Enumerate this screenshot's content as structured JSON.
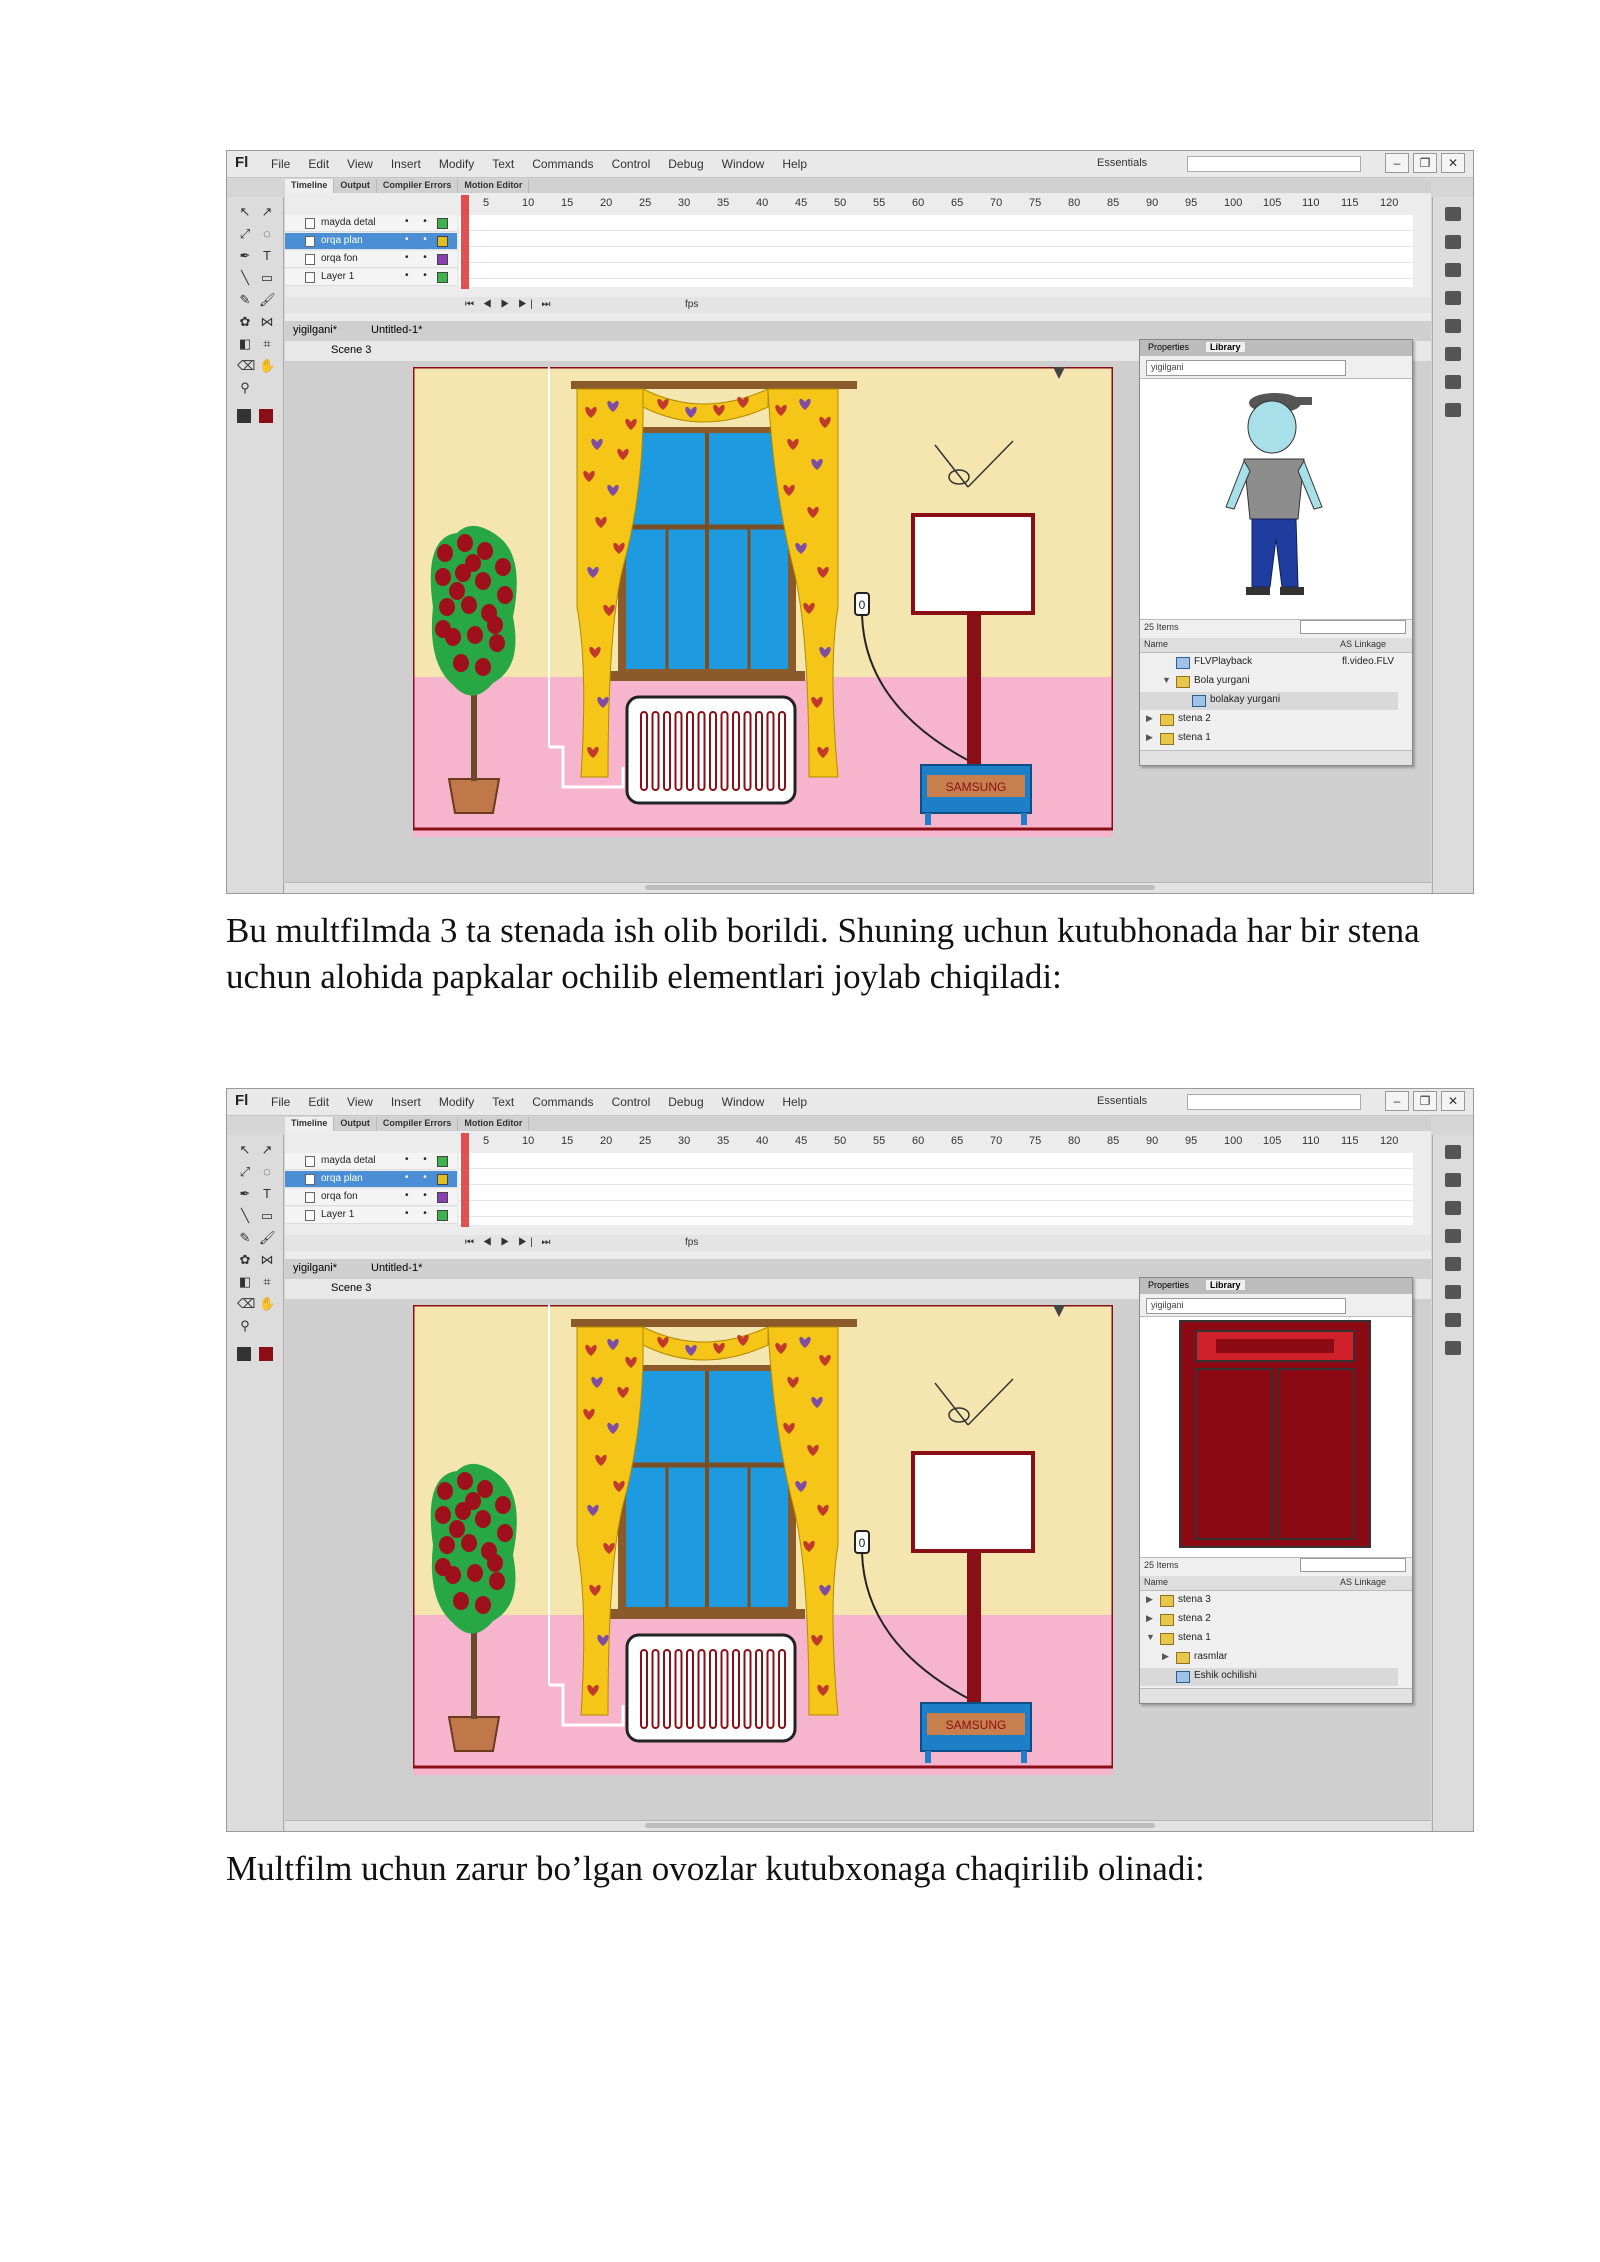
{
  "flash": {
    "logo": "Fl",
    "menu": [
      "File",
      "Edit",
      "View",
      "Insert",
      "Modify",
      "Text",
      "Commands",
      "Control",
      "Debug",
      "Window",
      "Help"
    ],
    "workspace": "Essentials",
    "timeline_tabs": [
      "Timeline",
      "Output",
      "Compiler Errors",
      "Motion Editor"
    ],
    "frame_numbers": [
      "5",
      "10",
      "15",
      "20",
      "25",
      "30",
      "35",
      "40",
      "45",
      "50",
      "55",
      "60",
      "65",
      "70",
      "75",
      "80",
      "85",
      "90",
      "95",
      "100",
      "105",
      "110",
      "115",
      "120"
    ],
    "layers": [
      {
        "name": "mayda detal",
        "color": "#3cb44b"
      },
      {
        "name": "orqa plan",
        "color": "#e0c020"
      },
      {
        "name": "orqa fon",
        "color": "#8a3fb5"
      },
      {
        "name": "Layer 1",
        "color": "#3cb44b"
      }
    ],
    "fps_label": "fps",
    "doc_tabs": [
      "yigilgani*",
      "Untitled-1*"
    ],
    "scene": "Scene 3",
    "panel_tabs": [
      "Properties",
      "Library"
    ],
    "library_file": "yigilgani",
    "item_count": "25 Items",
    "col_name": "Name",
    "col_linkage": "AS Linkage",
    "tv_brand": "SAMSUNG",
    "outlet_label": "0"
  },
  "screens": [
    {
      "preview": "character",
      "items": [
        {
          "name": "FLVPlayback",
          "linkage": "fl.video.FLV",
          "indent": 1,
          "type": "symbol",
          "arrow": ""
        },
        {
          "name": "Bola yurgani",
          "linkage": "",
          "indent": 1,
          "type": "folder",
          "arrow": "▼"
        },
        {
          "name": "bolakay yurgani",
          "linkage": "",
          "indent": 2,
          "type": "symbol",
          "arrow": "",
          "selected": true
        },
        {
          "name": "stena 2",
          "linkage": "",
          "indent": 0,
          "type": "folder",
          "arrow": "▶"
        },
        {
          "name": "stena 1",
          "linkage": "",
          "indent": 0,
          "type": "folder",
          "arrow": "▶"
        }
      ]
    },
    {
      "preview": "door",
      "items": [
        {
          "name": "stena 3",
          "linkage": "",
          "indent": 0,
          "type": "folder",
          "arrow": "▶"
        },
        {
          "name": "stena 2",
          "linkage": "",
          "indent": 0,
          "type": "folder",
          "arrow": "▶"
        },
        {
          "name": "stena 1",
          "linkage": "",
          "indent": 0,
          "type": "folder",
          "arrow": "▼"
        },
        {
          "name": "rasmlar",
          "linkage": "",
          "indent": 1,
          "type": "folder",
          "arrow": "▶"
        },
        {
          "name": "Eshik ochilishi",
          "linkage": "",
          "indent": 1,
          "type": "symbol",
          "arrow": "",
          "selected": true
        }
      ]
    }
  ],
  "paragraphs": {
    "p1": "Bu multfilmda 3 ta stenada ish olib borildi. Shuning uchun kutubhonada har bir stena uchun alohida papkalar ochilib elementlari joylab chiqiladi:",
    "p2": "Multfilm uchun zarur bo’lgan ovozlar kutubxonaga chaqirilib olinadi:"
  },
  "colors": {
    "wall": "#f5e6b0",
    "floor": "#f7b5cd",
    "curtain": "#f5c518",
    "window_glass": "#1e9be0",
    "wood": "#8a5a2b",
    "tree": "#28a745",
    "tree_fruit": "#a0101c",
    "tv_frame": "#8a0e16",
    "tv_stand": "#1c7fc8",
    "door": "#8b0a14"
  }
}
